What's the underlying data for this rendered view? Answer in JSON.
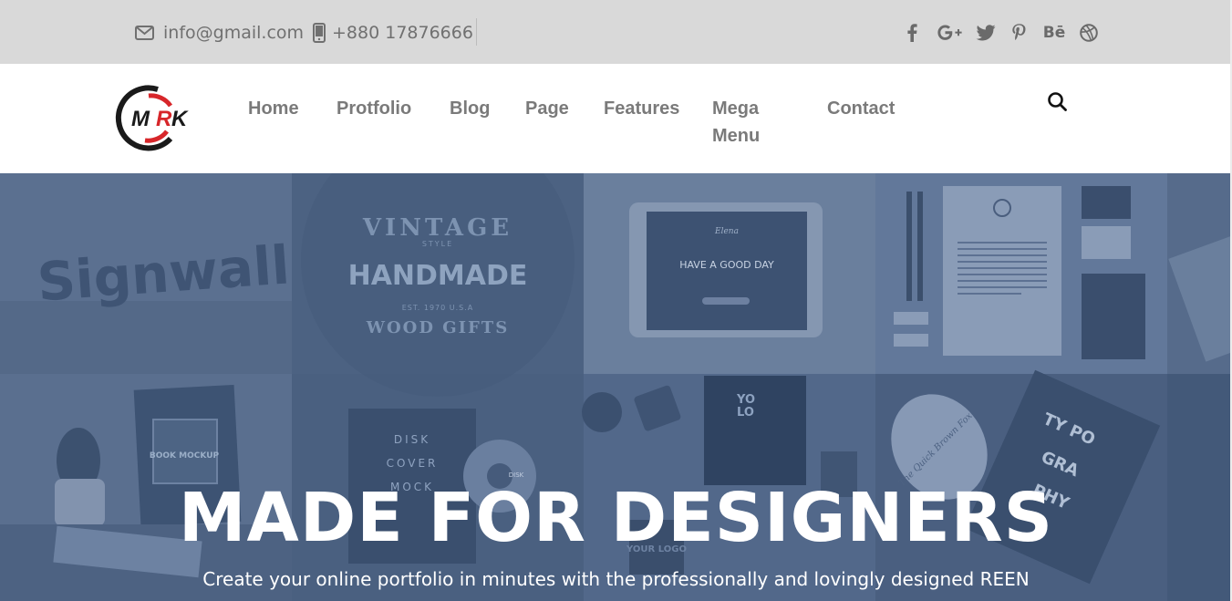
{
  "topbar": {
    "email": "info@gmail.com",
    "phone": "+880 17876666",
    "socials": {
      "facebook": "facebook-icon",
      "google_plus": "google-plus-icon",
      "twitter": "twitter-icon",
      "pinterest": "pinterest-icon",
      "behance": "Bē",
      "dribbble": "dribbble-icon"
    }
  },
  "header": {
    "logo_text": "MRK",
    "nav": [
      "Home",
      "Protfolio",
      "Blog",
      "Page",
      "Features",
      "Mega Menu",
      "Contact"
    ],
    "search_icon": "search-icon"
  },
  "hero": {
    "title": "MADE FOR DESIGNERS",
    "subtitle": "Create your online portfolio in minutes with the professionally and lovingly designed REEN",
    "mockups": {
      "signwall": "Signwall",
      "vintage": "VINTAGE",
      "style": "STYLE",
      "handmade": "HANDMADE",
      "est": "EST. 1970 U.S.A",
      "wood_gifts": "WOOD GIFTS",
      "tablet_brand": "Elena",
      "tablet_headline": "HAVE A GOOD DAY",
      "book_mockup": "BOOK MOCKUP",
      "disk": "DISK",
      "cover": "COVER",
      "mock": "MOCK",
      "your_logo": "YOUR LOGO",
      "your_logo_short": "YO LO",
      "typo": "TY PO GRA PHY",
      "quick_brown_fox": "The Quick Brown Fox"
    }
  },
  "colors": {
    "topbar_bg": "#d9d9d9",
    "hero_overlay": "#4e6484",
    "nav_text": "#7a7a7a",
    "logo_red": "#d7262a"
  }
}
